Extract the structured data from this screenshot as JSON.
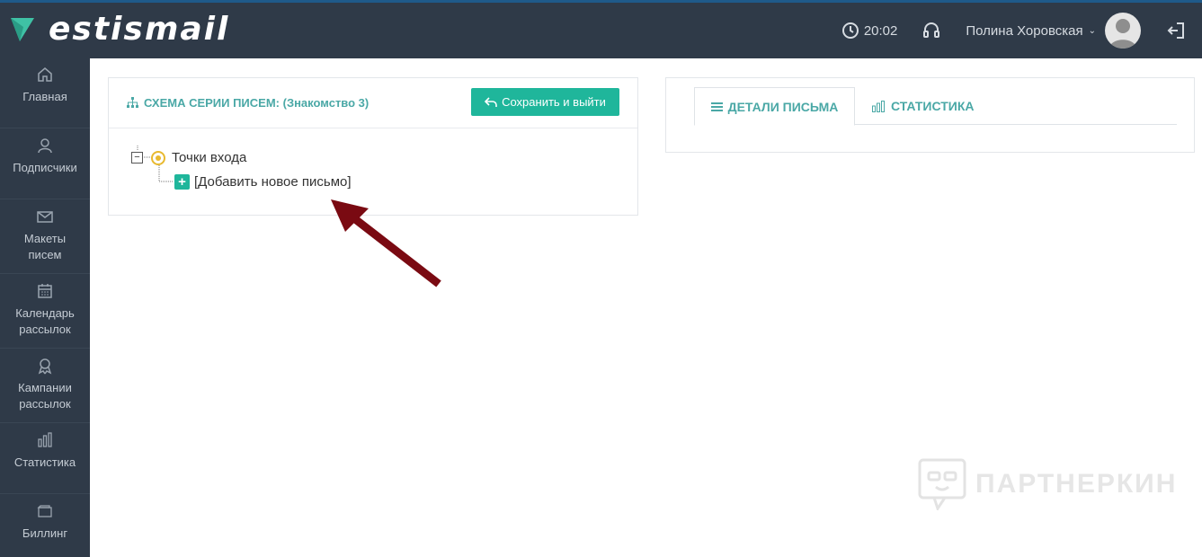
{
  "header": {
    "logo_text": "estismail",
    "time": "20:02",
    "user_name": "Полина Хоровская"
  },
  "sidebar": {
    "items": [
      {
        "label": "Главная",
        "icon": "home-icon"
      },
      {
        "label": "Подписчики",
        "icon": "user-icon"
      },
      {
        "label": "Макеты писем",
        "icon": "envelope-icon"
      },
      {
        "label": "Календарь рассылок",
        "icon": "calendar-icon"
      },
      {
        "label": "Кампании рассылок",
        "icon": "award-icon"
      },
      {
        "label": "Статистика",
        "icon": "bar-chart-icon"
      },
      {
        "label": "Биллинг",
        "icon": "wallet-icon"
      }
    ]
  },
  "scheme": {
    "title": "СХЕМА СЕРИИ ПИСЕМ: (Знакомство 3)",
    "save_label": "Сохранить и выйти",
    "tree": {
      "root_label": "Точки входа",
      "add_label": "[Добавить новое письмо]"
    }
  },
  "details": {
    "tabs": [
      {
        "label": "ДЕТАЛИ ПИСЬМА",
        "icon": "list-icon",
        "active": true
      },
      {
        "label": "СТАТИСТИКА",
        "icon": "bar-chart-icon",
        "active": false
      }
    ]
  },
  "watermark": {
    "text": "ПАРТНЕРКИН"
  },
  "colors": {
    "header_bg": "#2f3a48",
    "accent": "#1fb69b",
    "title_teal": "#4aa8a6",
    "arrow": "#7a0a12"
  }
}
